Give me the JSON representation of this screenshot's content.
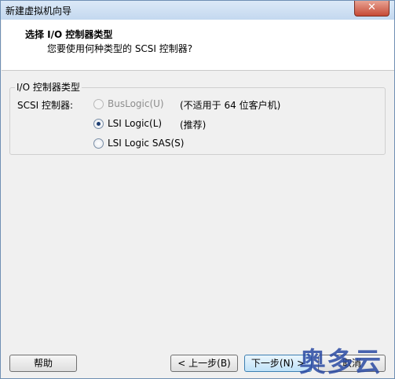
{
  "window": {
    "title": "新建虚拟机向导",
    "close_glyph": "✕"
  },
  "header": {
    "title": "选择 I/O 控制器类型",
    "subtitle": "您要使用何种类型的 SCSI 控制器?"
  },
  "group": {
    "legend": "I/O 控制器类型",
    "scsi_label": "SCSI 控制器:",
    "options": [
      {
        "label": "BusLogic(U)",
        "note": "(不适用于 64 位客户机)",
        "checked": false,
        "disabled": true
      },
      {
        "label": "LSI Logic(L)",
        "note": "(推荐)",
        "checked": true,
        "disabled": false
      },
      {
        "label": "LSI Logic SAS(S)",
        "note": "",
        "checked": false,
        "disabled": false
      }
    ]
  },
  "buttons": {
    "help": "帮助",
    "back": "< 上一步(B)",
    "next": "下一步(N) >",
    "cancel": "取消"
  },
  "watermark": "奥多云"
}
